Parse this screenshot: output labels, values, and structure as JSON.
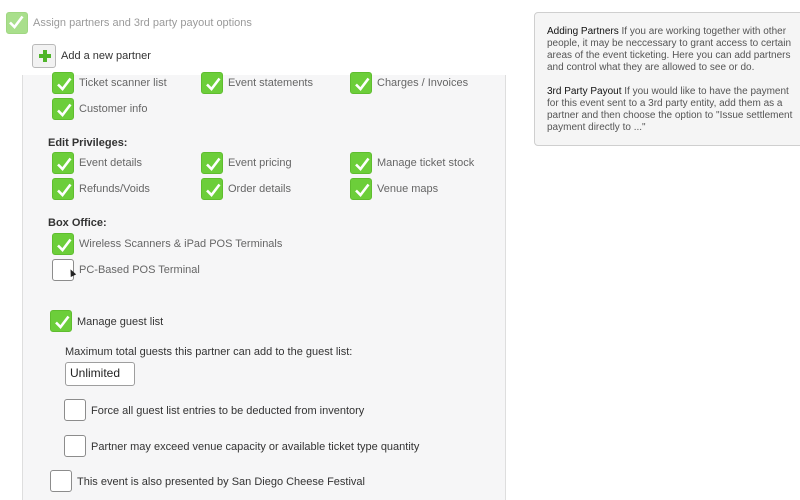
{
  "header": {
    "title": "Assign partners and 3rd party payout options",
    "add_partner_label": "Add a new partner"
  },
  "view_privileges": {
    "ticket_scanner_list": "Ticket scanner list",
    "event_statements": "Event statements",
    "charges_invoices": "Charges / Invoices",
    "customer_info": "Customer info"
  },
  "edit_privileges": {
    "heading": "Edit Privileges:",
    "event_details": "Event details",
    "event_pricing": "Event pricing",
    "manage_ticket_stock": "Manage ticket stock",
    "refunds_voids": "Refunds/Voids",
    "order_details": "Order details",
    "venue_maps": "Venue maps"
  },
  "box_office": {
    "heading": "Box Office:",
    "wireless_scanners": "Wireless Scanners & iPad POS Terminals",
    "pc_pos": "PC-Based POS Terminal"
  },
  "guest_list": {
    "manage_label": "Manage guest list",
    "max_guests_label": "Maximum total guests this partner can add to the guest list:",
    "max_guests_value": "Unlimited",
    "force_deduct_label": "Force all guest list entries to be deducted from inventory",
    "exceed_capacity_label": "Partner may exceed venue capacity or available ticket type quantity"
  },
  "presented_by_label": "This event is also presented by San Diego Cheese Festival",
  "info_panel": {
    "adding_title": "Adding Partners",
    "adding_text": " If you are working together with other people, it may be neccessary to grant access to certain areas of the event ticketing. Here you can add partners and control what they are allowed to see or do.",
    "payout_title": "3rd Party Payout",
    "payout_text": " If you would like to have the payment for this event sent to a 3rd party entity, add them as a partner and then choose the option to \"Issue settlement payment directly to ...\""
  },
  "colors": {
    "check_green": "#6cce3a",
    "plus_green": "#4fb52a"
  }
}
